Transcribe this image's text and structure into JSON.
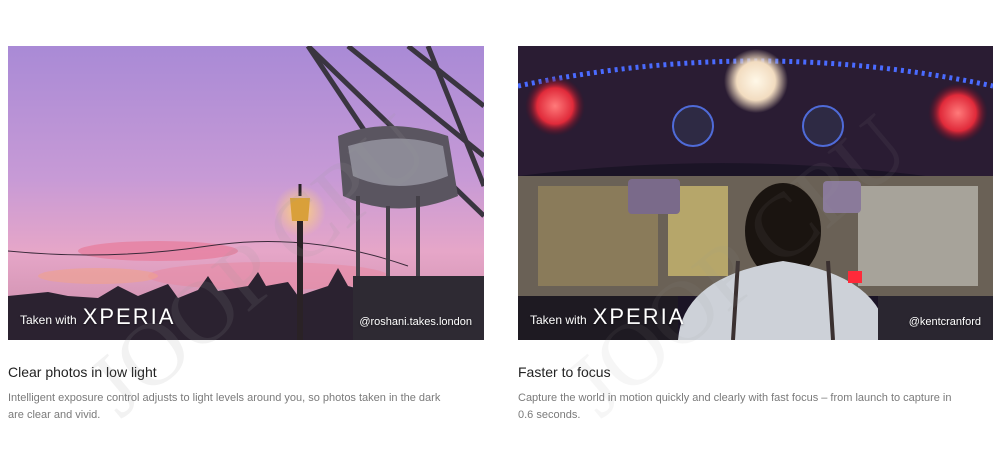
{
  "features": [
    {
      "badge_prefix": "Taken with",
      "badge_brand": "XPERIA",
      "credit": "@roshani.takes.london",
      "title": "Clear photos in low light",
      "description": "Intelligent exposure control adjusts to light levels around you, so photos taken in the dark are clear and vivid."
    },
    {
      "badge_prefix": "Taken with",
      "badge_brand": "XPERIA",
      "credit": "@kentcranford",
      "title": "Faster to focus",
      "description": "Capture the world in motion quickly and clearly with fast focus – from launch to capture in 0.6 seconds."
    }
  ],
  "watermark": "JOOP CPU"
}
